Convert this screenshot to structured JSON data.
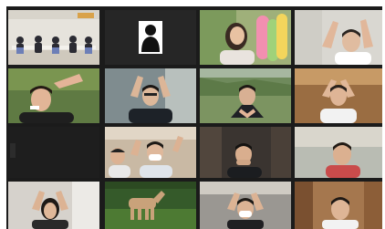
{
  "meeting": {
    "view": "gallery",
    "grid_columns": 4,
    "grid_rows": 4,
    "participant_count": 16,
    "video_on_count": 14,
    "video_off_count": 2
  },
  "tiles": [
    {
      "id": "tile-1-1",
      "content": "group-video",
      "video": true
    },
    {
      "id": "tile-1-2",
      "content": "profile-silhouette",
      "video": false
    },
    {
      "id": "tile-1-3",
      "content": "person-video",
      "video": true
    },
    {
      "id": "tile-1-4",
      "content": "person-video",
      "video": true
    },
    {
      "id": "tile-2-1",
      "content": "person-video",
      "video": true
    },
    {
      "id": "tile-2-2",
      "content": "person-video",
      "video": true
    },
    {
      "id": "tile-2-3",
      "content": "person-video",
      "video": true
    },
    {
      "id": "tile-2-4",
      "content": "person-video",
      "video": true
    },
    {
      "id": "tile-3-1",
      "content": "blank",
      "video": false
    },
    {
      "id": "tile-3-2",
      "content": "person-video",
      "video": true
    },
    {
      "id": "tile-3-3",
      "content": "person-video",
      "video": true
    },
    {
      "id": "tile-3-4",
      "content": "person-video",
      "video": true
    },
    {
      "id": "tile-4-1",
      "content": "person-video",
      "video": true
    },
    {
      "id": "tile-4-2",
      "content": "horse-video",
      "video": true
    },
    {
      "id": "tile-4-3",
      "content": "person-video",
      "video": true
    },
    {
      "id": "tile-4-4",
      "content": "person-video",
      "video": true
    }
  ],
  "colors": {
    "grid_background": "#1b1b1b",
    "page_background": "#ffffff",
    "video_off_tile": "#2a2a2a"
  }
}
